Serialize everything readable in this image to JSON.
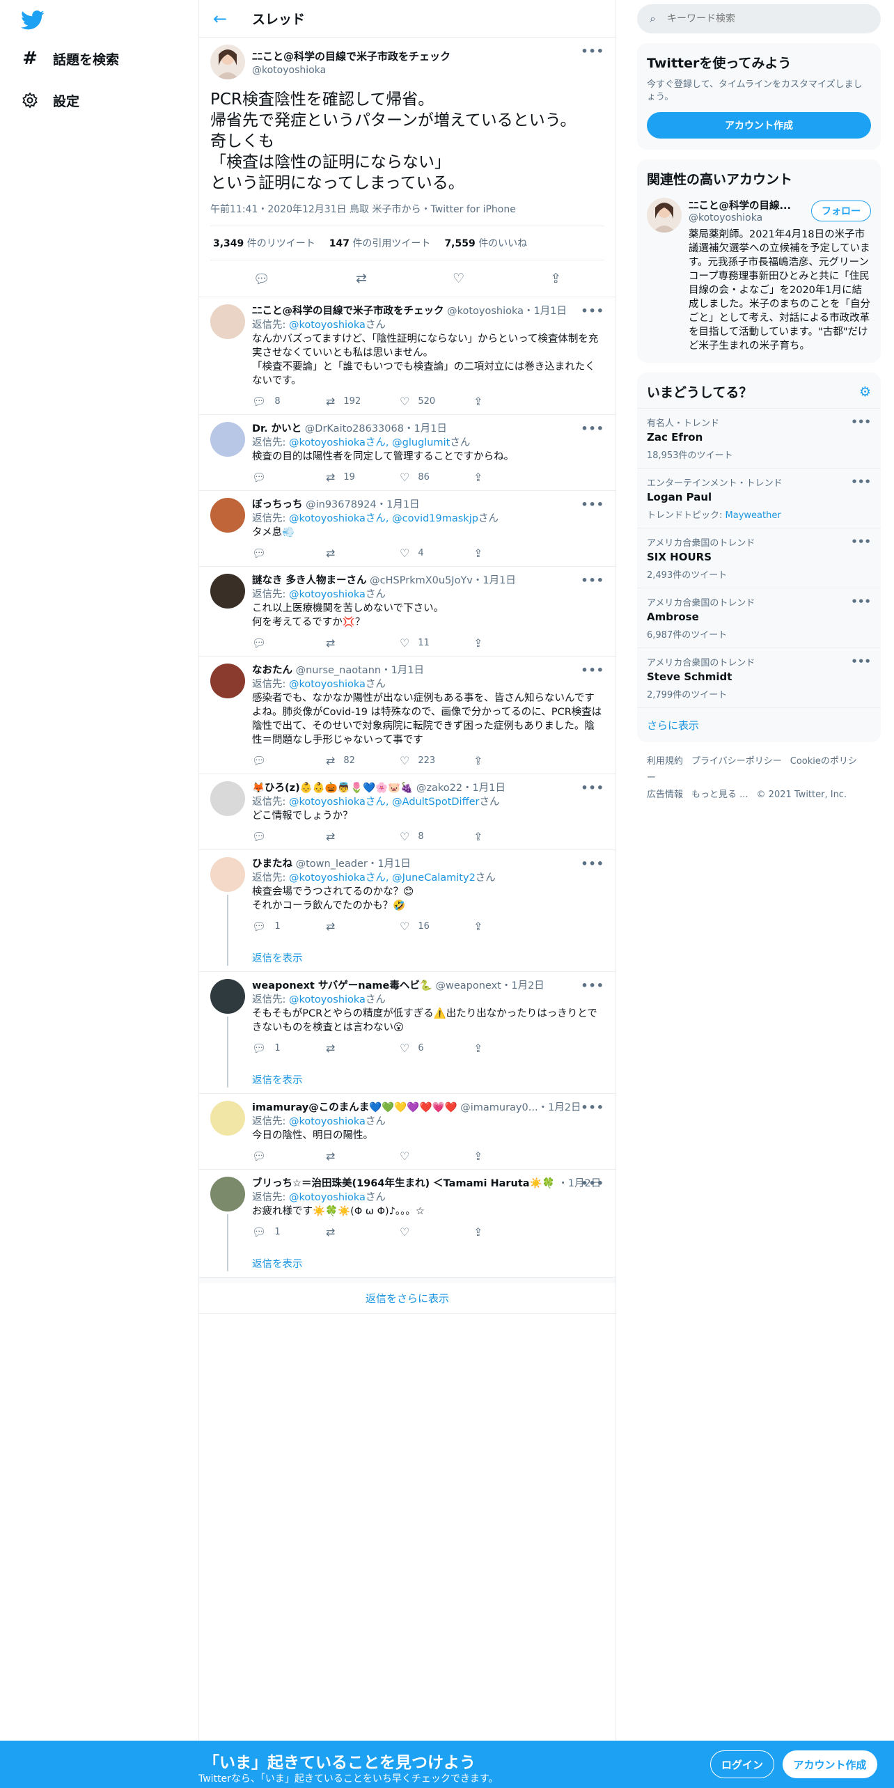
{
  "nav": {
    "explore_label": "話題を検索",
    "settings_label": "設定"
  },
  "header": {
    "title": "スレッド"
  },
  "main_tweet": {
    "name": "ﾆﾆこと@科学の目線で米子市政をチェック",
    "handle": "@kotoyoshioka",
    "text": "PCR検査陰性を確認して帰省。\n帰省先で発症というパターンが増えているという。\n奇しくも\n「検査は陰性の証明にならない」\nという証明になってしまっている。",
    "meta": "午前11:41・2020年12月31日 鳥取 米子市から・Twitter for iPhone",
    "retweets_count": "3,349",
    "retweets_label": "件のリツイート",
    "quotes_count": "147",
    "quotes_label": "件の引用ツイート",
    "likes_count": "7,559",
    "likes_label": "件のいいね"
  },
  "replies": [
    {
      "name": "ﾆﾆこと@科学の目線で米子市政をチェック",
      "meta": "@kotoyoshioka・1月1日",
      "to_prefix": "返信先: ",
      "to": "@kotoyoshioka",
      "to_suffix": "さん",
      "text": "なんかバズってますけど、「陰性証明にならない」からといって検査体制を充実させなくていいとも私は思いません。\n「検査不要論」と「誰でもいつでも検査論」の二項対立には巻き込まれたくないです。",
      "reply_count": "8",
      "retweet_count": "192",
      "like_count": "520",
      "avatar_color": "#e9d4c6"
    },
    {
      "name": "Dr. かいと",
      "meta": "@DrKaito28633068・1月1日",
      "to_prefix": "返信先: ",
      "to": "@kotoyoshiokaさん, @gluglumit",
      "to_suffix": "さん",
      "text": "検査の目的は陽性者を同定して管理することですからね。",
      "reply_count": "",
      "retweet_count": "19",
      "like_count": "86",
      "avatar_color": "#b8c7e6"
    },
    {
      "name": "ぼっちっち",
      "meta": "@in93678924・1月1日",
      "to_prefix": "返信先: ",
      "to": "@kotoyoshiokaさん, @covid19maskjp",
      "to_suffix": "さん",
      "text": "タメ息💨",
      "reply_count": "",
      "retweet_count": "",
      "like_count": "4",
      "avatar_color": "#c0653a"
    },
    {
      "name": "謎なき 多き人物まーさん",
      "meta": "@cHSPrkmX0u5JoYv・1月1日",
      "to_prefix": "返信先: ",
      "to": "@kotoyoshioka",
      "to_suffix": "さん",
      "text": "これ以上医療機関を苦しめないで下さい。\n何を考えてるですか💢？",
      "reply_count": "",
      "retweet_count": "",
      "like_count": "11",
      "avatar_color": "#3a2f26"
    },
    {
      "name": "なおたん",
      "meta": "@nurse_naotann・1月1日",
      "to_prefix": "返信先: ",
      "to": "@kotoyoshioka",
      "to_suffix": "さん",
      "text": "感染者でも、なかなか陽性が出ない症例もある事を、皆さん知らないんですよね。肺炎像がCovid-19 は特殊なので、画像で分かってるのに、PCR検査は陰性で出て、そのせいで対象病院に転院できず困った症例もありました。陰性＝問題なし手形じゃないって事です",
      "reply_count": "",
      "retweet_count": "82",
      "like_count": "223",
      "avatar_color": "#8a3b2e"
    },
    {
      "name": "🦊ひろ(z)👶👶🎃👼🌷💙🌸🐷🍇",
      "meta": "@zako22・1月1日",
      "to_prefix": "返信先: ",
      "to": "@kotoyoshiokaさん, @AdultSpotDiffer",
      "to_suffix": "さん",
      "text": "どこ情報でしょうか？",
      "reply_count": "",
      "retweet_count": "",
      "like_count": "8",
      "avatar_color": "#d9d9d9"
    },
    {
      "name": "ひまたね",
      "meta": "@town_leader・1月1日",
      "to_prefix": "返信先: ",
      "to": "@kotoyoshiokaさん, @JuneCalamity2",
      "to_suffix": "さん",
      "text": "検査会場でうつされてるのかな？😊\nそれかコーラ飲んでたのかも？🤣",
      "reply_count": "1",
      "retweet_count": "",
      "like_count": "16",
      "show_replies": "返信を表示",
      "avatar_color": "#f4d9c8"
    },
    {
      "name": "weaponext サバゲーname毒ヘビ🐍",
      "meta": "@weaponext・1月2日",
      "to_prefix": "返信先: ",
      "to": "@kotoyoshioka",
      "to_suffix": "さん",
      "text": "そもそもがPCRとやらの精度が低すぎる⚠️出たり出なかったりはっきりとできないものを検査とは言わない😮",
      "reply_count": "1",
      "retweet_count": "",
      "like_count": "6",
      "show_replies": "返信を表示",
      "avatar_color": "#2f3a3f"
    },
    {
      "name": "imamuray@このまんま💙💚💛💜❤️💗❤️",
      "meta": "@imamuray0...・1月2日",
      "to_prefix": "返信先: ",
      "to": "@kotoyoshioka",
      "to_suffix": "さん",
      "text": "今日の陰性、明日の陽性。",
      "reply_count": "",
      "retweet_count": "",
      "like_count": "",
      "avatar_color": "#f2e6a6"
    },
    {
      "name": "ブリっち☆＝治田珠美(1964年生まれ) ＜Tamami Haruta☀️🍀",
      "meta": "・1月2日",
      "to_prefix": "返信先: ",
      "to": "@kotoyoshioka",
      "to_suffix": "さん",
      "text": "お疲れ様です☀️🍀☀️(Φ ω Φ)♪。。。☆",
      "reply_count": "1",
      "retweet_count": "",
      "like_count": "",
      "show_replies": "返信を表示",
      "avatar_color": "#7a8a6a"
    }
  ],
  "more_replies": "返信をさらに表示",
  "search": {
    "placeholder": "キーワード検索"
  },
  "signup_card": {
    "title": "Twitterを使ってみよう",
    "desc": "今すぐ登録して、タイムラインをカスタマイズしましょう。",
    "button": "アカウント作成"
  },
  "related": {
    "title": "関連性の高いアカウント",
    "name": "ﾆﾆこと@科学の目線...",
    "handle": "@kotoyoshioka",
    "follow": "フォロー",
    "bio": "薬局薬剤師。2021年4月18日の米子市議選補欠選挙への立候補を予定しています。元我孫子市長福嶋浩彦、元グリーンコープ専務理事新田ひとみと共に「住民目線の会・よなご」を2020年1月に結成しました。米子のまちのことを「自分ごと」として考え、対話による市政改革を目指して活動しています。\"古都\"だけど米子生まれの米子育ち。"
  },
  "trends": {
    "title": "いまどうしてる？",
    "items": [
      {
        "context": "有名人・トレンド",
        "name": "Zac Efron",
        "count": "18,953件のツイート"
      },
      {
        "context": "エンターテインメント・トレンド",
        "name": "Logan Paul",
        "count_prefix": "トレンドトピック: ",
        "count_link": "Mayweather"
      },
      {
        "context": "アメリカ合衆国のトレンド",
        "name": "SIX HOURS",
        "count": "2,493件のツイート"
      },
      {
        "context": "アメリカ合衆国のトレンド",
        "name": "Ambrose",
        "count": "6,987件のツイート"
      },
      {
        "context": "アメリカ合衆国のトレンド",
        "name": "Steve Schmidt",
        "count": "2,799件のツイート"
      }
    ],
    "show_more": "さらに表示"
  },
  "footer": {
    "terms": "利用規約",
    "privacy": "プライバシーポリシー",
    "cookie": "Cookieのポリシー",
    "ads": "広告情報",
    "more": "もっと見る ...",
    "copyright": "© 2021 Twitter, Inc."
  },
  "bottombar": {
    "headline": "「いま」起きていることを見つけよう",
    "sub": "Twitterなら、「いま」起きていることをいち早くチェックできます。",
    "login": "ログイン",
    "signup": "アカウント作成"
  }
}
